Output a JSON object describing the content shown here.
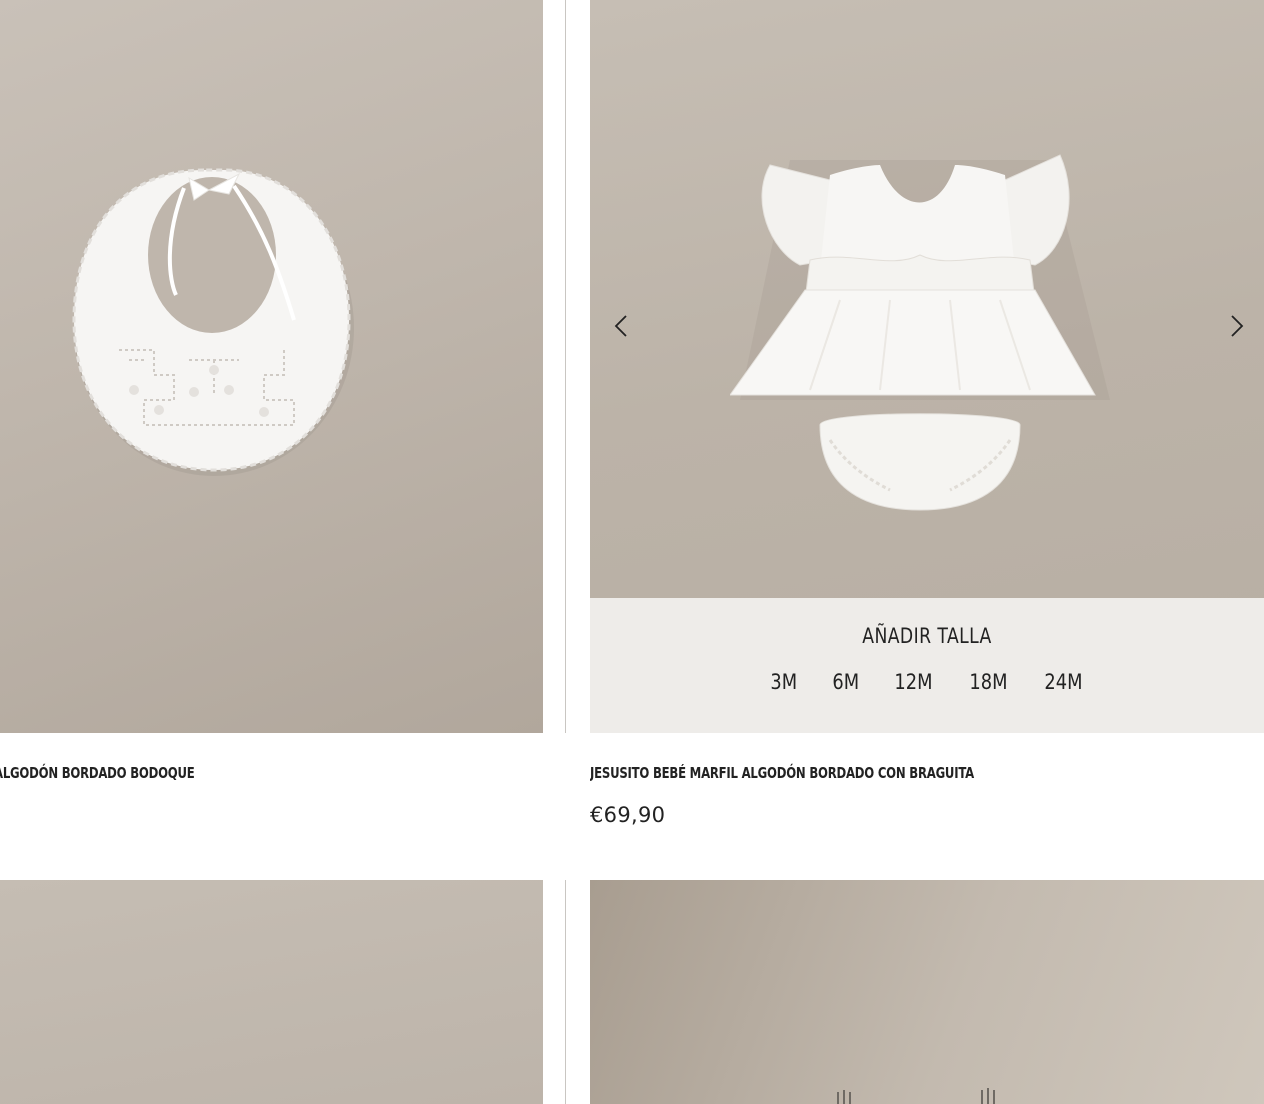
{
  "products": [
    {
      "name": "ALGODÓN BORDADO BODOQUE",
      "icon": "baby-bib-image"
    },
    {
      "name": "JESUSITO BEBÉ MARFIL ALGODÓN BORDADO CON BRAGUITA",
      "price": "€69,90",
      "icon": "baby-dress-image",
      "size_panel": {
        "title": "AÑADIR TALLA",
        "sizes": [
          "3M",
          "6M",
          "12M",
          "18M",
          "24M"
        ]
      },
      "carousel": {
        "prev_icon": "chevron-left-icon",
        "next_icon": "chevron-right-icon"
      }
    }
  ],
  "colors": {
    "text": "#222222",
    "photo_background": "#bfb6ac",
    "panel_background": "#f0eeeb"
  }
}
